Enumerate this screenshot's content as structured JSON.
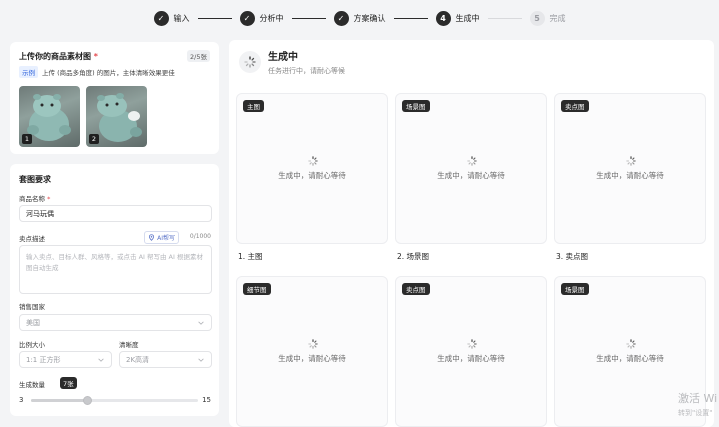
{
  "stepper": {
    "steps": [
      {
        "num": "✓",
        "label": "输入",
        "state": "done"
      },
      {
        "num": "✓",
        "label": "分析中",
        "state": "done"
      },
      {
        "num": "✓",
        "label": "方案确认",
        "state": "done"
      },
      {
        "num": "4",
        "label": "生成中",
        "state": "active"
      },
      {
        "num": "5",
        "label": "完成",
        "state": "pending"
      }
    ]
  },
  "upload": {
    "title": "上传你的商品素材图",
    "required_mark": "*",
    "count": "2/5张",
    "example_tag": "示例",
    "hint": "上传 (商品多角度) 的图片，主体清晰效果更佳",
    "thumbs": [
      {
        "index": "1"
      },
      {
        "index": "2"
      }
    ]
  },
  "requirements": {
    "title": "套图要求",
    "product_name_label": "商品名称",
    "product_name_required": "*",
    "product_name_value": "河马玩偶",
    "selling_points_label": "卖点描述",
    "ai_write_label": "AI帮写",
    "char_count": "0/1000",
    "selling_points_placeholder": "输入卖点、目标人群、风格等，或点击 AI 帮写由 AI 根据素材图自动生成",
    "country_label": "销售国家",
    "country_value": "美国",
    "ratio_label": "比例大小",
    "ratio_value": "1:1 正方形",
    "resolution_label": "清晰度",
    "resolution_value": "2K高清",
    "quantity_label": "生成数量",
    "quantity_value": "7张",
    "slider_min": "3",
    "slider_max": "15",
    "slider_value": 7
  },
  "main": {
    "title": "生成中",
    "subtitle": "任务进行中，请耐心等候",
    "loading_text": "生成中，请耐心等待",
    "tiles": [
      {
        "tag": "主图",
        "caption": "1. 主图"
      },
      {
        "tag": "场景图",
        "caption": "2. 场景图"
      },
      {
        "tag": "卖点图",
        "caption": "3. 卖点图"
      },
      {
        "tag": "细节图",
        "caption": ""
      },
      {
        "tag": "卖点图",
        "caption": ""
      },
      {
        "tag": "场景图",
        "caption": ""
      }
    ]
  },
  "watermark": {
    "line1": "激活 Wi",
    "line2": "转到\"设置\""
  }
}
